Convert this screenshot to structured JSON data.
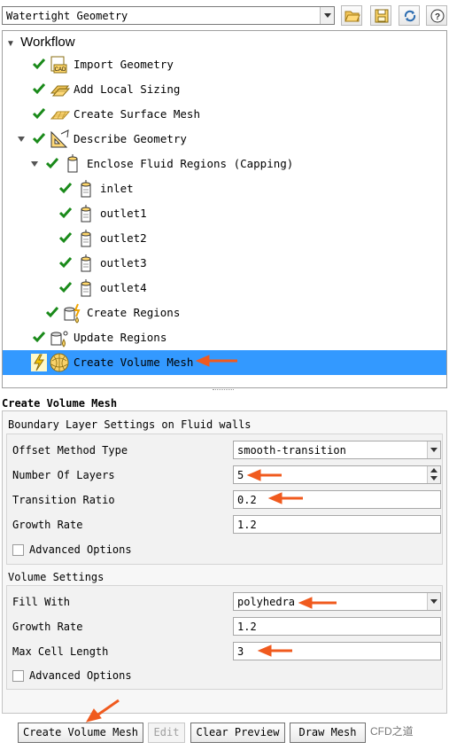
{
  "toolbar": {
    "workflow_select_value": "Watertight Geometry",
    "icons": [
      "open-folder-icon",
      "save-icon",
      "refresh-icon",
      "help-icon"
    ]
  },
  "workflow": {
    "title": "Workflow",
    "items": [
      {
        "label": "Import Geometry",
        "status": "done",
        "icon": "cad-import-icon"
      },
      {
        "label": "Add Local Sizing",
        "status": "done",
        "icon": "local-sizing-icon"
      },
      {
        "label": "Create Surface Mesh",
        "status": "done",
        "icon": "surface-mesh-icon"
      },
      {
        "label": "Describe Geometry",
        "status": "done",
        "icon": "describe-geometry-icon"
      },
      {
        "label": "Enclose Fluid Regions (Capping)",
        "status": "done",
        "icon": "capping-icon"
      },
      {
        "label": "inlet",
        "status": "done",
        "icon": "cap-icon"
      },
      {
        "label": "outlet1",
        "status": "done",
        "icon": "cap-icon"
      },
      {
        "label": "outlet2",
        "status": "done",
        "icon": "cap-icon"
      },
      {
        "label": "outlet3",
        "status": "done",
        "icon": "cap-icon"
      },
      {
        "label": "outlet4",
        "status": "done",
        "icon": "cap-icon"
      },
      {
        "label": "Create Regions",
        "status": "done",
        "icon": "create-regions-icon"
      },
      {
        "label": "Update Regions",
        "status": "done",
        "icon": "update-regions-icon"
      },
      {
        "label": "Create Volume Mesh",
        "status": "pending",
        "icon": "volume-mesh-icon",
        "selected": true
      }
    ]
  },
  "task": {
    "title": "Create Volume Mesh",
    "boundary_layer": {
      "heading": "Boundary Layer Settings on Fluid walls",
      "offset_method_label": "Offset Method Type",
      "offset_method_value": "smooth-transition",
      "layers_label": "Number Of Layers",
      "layers_value": "5",
      "transition_label": "Transition Ratio",
      "transition_value": "0.2",
      "growth_label": "Growth Rate",
      "growth_value": "1.2",
      "advanced_label": "Advanced Options"
    },
    "volume": {
      "heading": "Volume Settings",
      "fill_label": "Fill With",
      "fill_value": "polyhedra",
      "growth_label": "Growth Rate",
      "growth_value": "1.2",
      "max_cell_label": "Max Cell Length",
      "max_cell_value": "3",
      "advanced_label": "Advanced Options"
    }
  },
  "buttons": {
    "create": "Create Volume Mesh",
    "edit": "Edit",
    "clear": "Clear Preview",
    "draw": "Draw Mesh",
    "watermark": "CFD之道"
  },
  "colors": {
    "selection": "#3399ff",
    "check": "#1a8a1a",
    "annotation_arrow": "#f05a1e"
  }
}
